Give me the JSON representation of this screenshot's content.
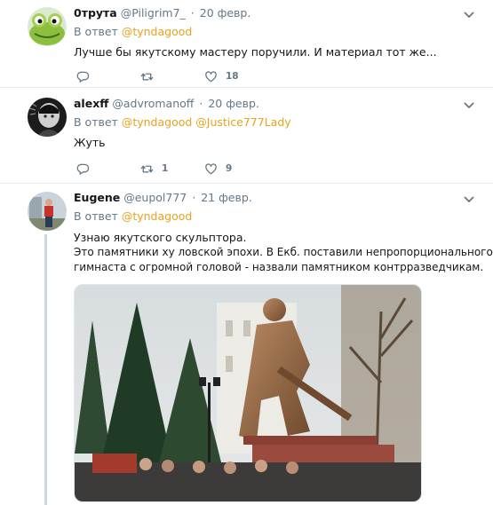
{
  "tweets": [
    {
      "name": "0трута",
      "handle": "@Piligrim7_",
      "dot": "·",
      "date": "20 февр.",
      "reply_prefix": "В ответ",
      "reply_to": [
        "@tyndagood"
      ],
      "text": [
        "Лучше бы якутскому мастеру поручили. И материал тот же..."
      ],
      "replies": "",
      "retweets": "",
      "likes": "18"
    },
    {
      "name": "alexff",
      "handle": "@advromanoff",
      "dot": "·",
      "date": "20 февр.",
      "reply_prefix": "В ответ",
      "reply_to": [
        "@tyndagood",
        "@Justice777Lady"
      ],
      "text": [
        "Жуть"
      ],
      "replies": "",
      "retweets": "1",
      "likes": "9"
    },
    {
      "name": "Eugene",
      "handle": "@eupol777",
      "dot": "·",
      "date": "21 февр.",
      "reply_prefix": "В ответ",
      "reply_to": [
        "@tyndagood"
      ],
      "text": [
        "Узнаю якутского скульптора.",
        "Это памятники ху   ловской эпохи. В Екб. поставили непропорционального",
        "гимнаста с огромной головой - назвали памятником контрразведчикам."
      ]
    }
  ],
  "colors": {
    "link": "#e8a31c",
    "muted": "#657786",
    "divider": "#e6ecf0"
  }
}
